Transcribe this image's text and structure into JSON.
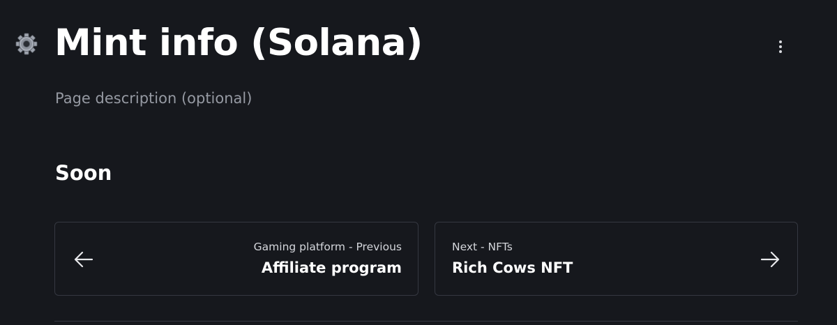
{
  "page": {
    "icon": "gear-icon",
    "title": "Mint info (Solana)",
    "description": "Page description (optional)",
    "more_menu_icon": "more-vertical-icon"
  },
  "content": {
    "heading": "Soon"
  },
  "pagination": {
    "previous": {
      "subtitle": "Gaming platform - Previous",
      "title": "Affiliate program",
      "icon": "arrow-left-icon"
    },
    "next": {
      "subtitle": "Next - NFTs",
      "title": "Rich Cows NFT",
      "icon": "arrow-right-icon"
    }
  },
  "colors": {
    "background": "#16181d",
    "text": "#ffffff",
    "muted_text": "#9599a2",
    "border": "#353841"
  }
}
